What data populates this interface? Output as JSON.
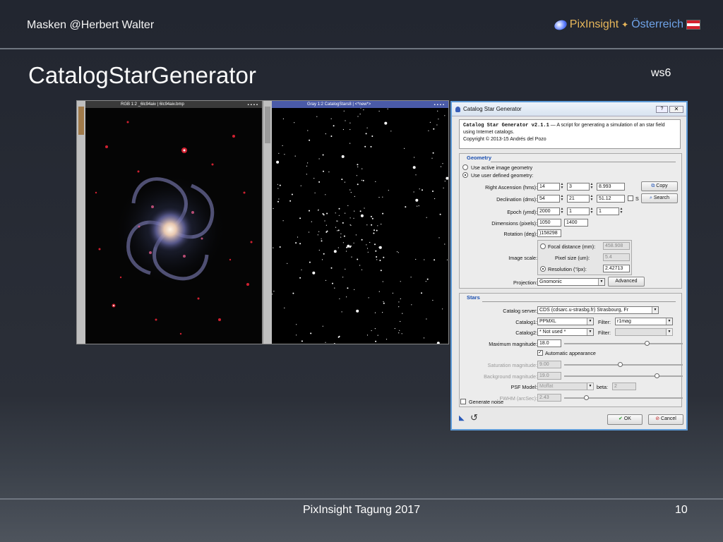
{
  "header": {
    "left": "Masken  @Herbert Walter",
    "brand": "PixInsight",
    "country": "Österreich"
  },
  "slide": {
    "title": "CatalogStarGenerator",
    "tag": "ws6",
    "footer": "PixInsight Tagung 2017",
    "page": "10"
  },
  "colors": {
    "accent_gold": "#e8b75a",
    "accent_blue": "#6fa3e8",
    "flag_red": "#d4202c"
  },
  "windows": {
    "rgb": {
      "title": "RGB 1:2 _6lc94aiv | 6lc94aiv.bmp",
      "tab": "_6lc94aiv"
    },
    "gray": {
      "title": "Gray 1:2 CatalogStars8 | <*new*>",
      "tab": "CatalogStars8"
    }
  },
  "dialog": {
    "title": "Catalog Star Generator",
    "help": "?",
    "close": "✕",
    "info_title": "Catalog Star Generator v2.1.1",
    "info_text": " — A script for generating a simulation of an star field using Internet catalogs.",
    "copyright": "Copyright © 2013-15 Andrés del Pozo",
    "geometry": {
      "header": "Geometry",
      "opt_active": "Use active image geometry",
      "opt_user": "Use user defined geometry:",
      "ra_label": "Right Ascension (hms):",
      "ra": [
        "14",
        "3",
        "8.993"
      ],
      "dec_label": "Declination (dms):",
      "dec": [
        "54",
        "21",
        "51.12"
      ],
      "s_label": "S",
      "epoch_label": "Epoch (ymd):",
      "epoch": [
        "2000",
        "1",
        "1"
      ],
      "dim_label": "Dimensions (pixels):",
      "dim": [
        "1050",
        "1400"
      ],
      "rot_label": "Rotation (deg):",
      "rot": ")158298",
      "copy_btn": "Copy",
      "search_btn": "Search",
      "scale_label": "Image scale:",
      "focal_label": "Focal distance (mm):",
      "focal": "458.908",
      "pixel_label": "Pixel size (um):",
      "pixel": "5.4",
      "res_label": "Resolution (\"/px):",
      "res": "2.42713",
      "proj_label": "Projection:",
      "proj": "Gnomonic",
      "advanced_btn": "Advanced"
    },
    "stars": {
      "header": "Stars",
      "server_label": "Catalog server:",
      "server": "CDS (cdsarc.u-strasbg.fr) Strasbourg, Fr",
      "cat1_label": "Catalog1:",
      "cat1": "PPMXL",
      "filter_label": "Filter:",
      "filter1": "r1mag",
      "cat2_label": "Catalog2:",
      "cat2": "* Not used *",
      "filter2": "",
      "maxmag_label": "Maximum magnitude:",
      "maxmag": "18.0",
      "auto_label": "Automatic appearance",
      "satmag_label": "Saturation magnitude:",
      "satmag": "9.00",
      "bgmag_label": "Background magnitude:",
      "bgmag": "19.0",
      "psf_label": "PSF Model:",
      "psf": "Moffat",
      "beta_label": "beta:",
      "beta": "2",
      "fwhm_label": "FWHM (arcSec):",
      "fwhm": "2.43",
      "noise_label": "Generate noise"
    },
    "ok_btn": "OK",
    "cancel_btn": "Cancel"
  }
}
